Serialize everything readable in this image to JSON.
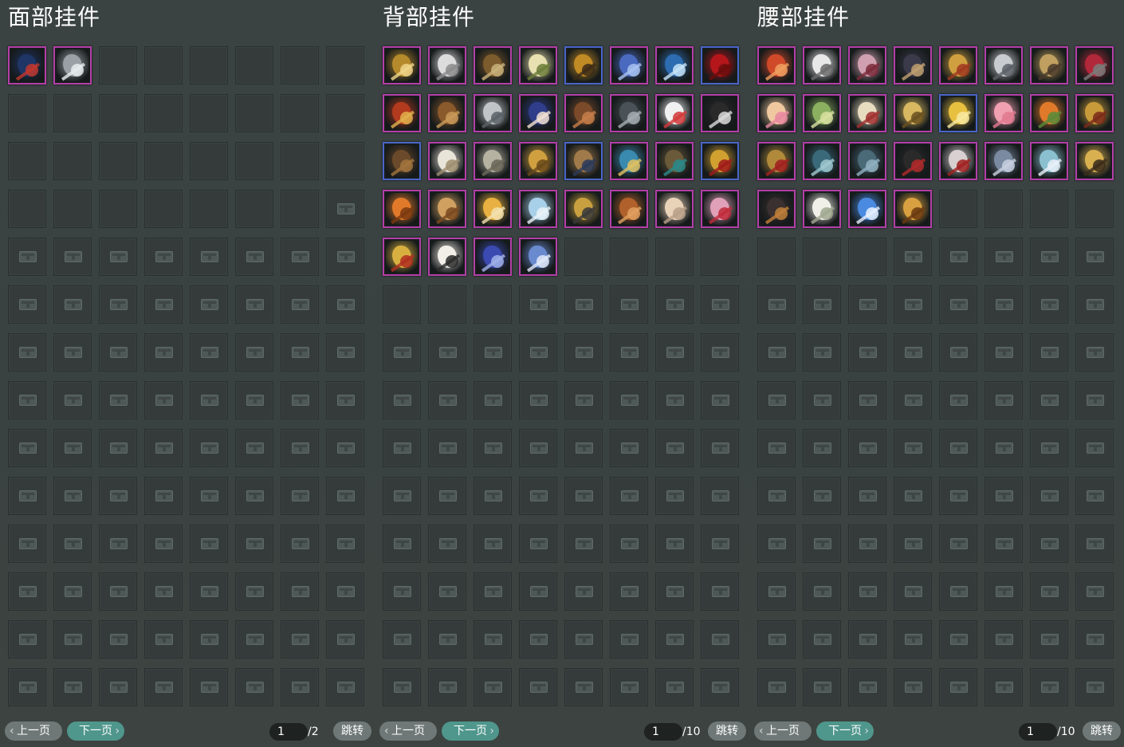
{
  "panels": [
    {
      "id": "face",
      "title": "面部挂件",
      "unlocked_slots": 31,
      "items": [
        {
          "icon": "blue-flower-hairpin-icon",
          "frame": "purple",
          "c1": "#1f3566",
          "c2": "#c2372d"
        },
        {
          "icon": "silver-mask-icon",
          "frame": "purple",
          "c1": "#9aa0a6",
          "c2": "#e7ecef"
        }
      ],
      "pager": {
        "prev_label": "上一页",
        "next_label": "下一页",
        "current_page": "1",
        "total_label": "/2",
        "jump_label": "跳转"
      }
    },
    {
      "id": "back",
      "title": "背部挂件",
      "unlocked_slots": 43,
      "items": [
        {
          "icon": "golden-wings-icon",
          "frame": "purple",
          "c1": "#b58a2c",
          "c2": "#f0d58a"
        },
        {
          "icon": "white-wings-icon",
          "frame": "purple",
          "c1": "#dcdcdc",
          "c2": "#8c8c8c"
        },
        {
          "icon": "ornate-fan-icon",
          "frame": "purple",
          "c1": "#7c5b2c",
          "c2": "#c9b27a"
        },
        {
          "icon": "lotus-flower-icon",
          "frame": "purple",
          "c1": "#e8e0b0",
          "c2": "#6c7d3a"
        },
        {
          "icon": "golden-guqin-icon",
          "frame": "blue",
          "c1": "#c08a24",
          "c2": "#3b2a18"
        },
        {
          "icon": "blue-rune-orb-icon",
          "frame": "purple",
          "c1": "#4a6ac0",
          "c2": "#a7c2f0"
        },
        {
          "icon": "blue-crystal-blade-icon",
          "frame": "purple",
          "c1": "#2d6cb0",
          "c2": "#c7e3f7"
        },
        {
          "icon": "red-phoenix-icon",
          "frame": "blue",
          "c1": "#b5161b",
          "c2": "#6a0d0d"
        },
        {
          "icon": "red-gold-fan-icon",
          "frame": "purple",
          "c1": "#b23a1e",
          "c2": "#e0b04c"
        },
        {
          "icon": "bird-cage-icon",
          "frame": "purple",
          "c1": "#8a5a2c",
          "c2": "#c89a5a"
        },
        {
          "icon": "silver-hammer-icon",
          "frame": "purple",
          "c1": "#c0c4c6",
          "c2": "#5a6266"
        },
        {
          "icon": "blue-penguin-icon",
          "frame": "purple",
          "c1": "#2f3d8a",
          "c2": "#f2e2d2"
        },
        {
          "icon": "wooden-kite-icon",
          "frame": "purple",
          "c1": "#7a4a2a",
          "c2": "#c67e4a"
        },
        {
          "icon": "dark-sword-bundle-icon",
          "frame": "purple",
          "c1": "#4a5258",
          "c2": "#a4adb2"
        },
        {
          "icon": "snowman-doll-icon",
          "frame": "purple",
          "c1": "#f1f1f1",
          "c2": "#d23a3a"
        },
        {
          "icon": "dark-thorn-ring-icon",
          "frame": "purple",
          "c1": "#2a2a2a",
          "c2": "#dadada"
        },
        {
          "icon": "wooden-barrel-icon",
          "frame": "blue",
          "c1": "#6a4a2a",
          "c2": "#a2743e"
        },
        {
          "icon": "white-vase-icon",
          "frame": "purple",
          "c1": "#e9e4d8",
          "c2": "#9f8f70"
        },
        {
          "icon": "silver-feather-disc-icon",
          "frame": "purple",
          "c1": "#b6b2a2",
          "c2": "#6b6658"
        },
        {
          "icon": "golden-scroll-sword-icon",
          "frame": "purple",
          "c1": "#d0a040",
          "c2": "#6a4a1a"
        },
        {
          "icon": "wooden-xylophone-icon",
          "frame": "blue",
          "c1": "#a07a4a",
          "c2": "#2a3a5a"
        },
        {
          "icon": "kingfisher-bird-icon",
          "frame": "purple",
          "c1": "#3a8ab0",
          "c2": "#e0c060"
        },
        {
          "icon": "wooden-cabinet-icon",
          "frame": "purple",
          "c1": "#6a5a3a",
          "c2": "#2a8a8a"
        },
        {
          "icon": "golden-red-chain-icon",
          "frame": "blue",
          "c1": "#d0a030",
          "c2": "#a01a1a"
        },
        {
          "icon": "orange-sun-orb-icon",
          "frame": "purple",
          "c1": "#e07a2a",
          "c2": "#7a3a10"
        },
        {
          "icon": "lantern-shrine-icon",
          "frame": "purple",
          "c1": "#d0a060",
          "c2": "#7a4a20"
        },
        {
          "icon": "golden-rabbit-icon",
          "frame": "purple",
          "c1": "#e8b040",
          "c2": "#f2e2b0"
        },
        {
          "icon": "snow-globe-icon",
          "frame": "purple",
          "c1": "#a8d0e8",
          "c2": "#e8f2f8"
        },
        {
          "icon": "golden-crossed-swords-icon",
          "frame": "purple",
          "c1": "#c8a040",
          "c2": "#3a3a3a"
        },
        {
          "icon": "bronze-shield-icon",
          "frame": "purple",
          "c1": "#b0602a",
          "c2": "#e0a060"
        },
        {
          "icon": "seashell-icon",
          "frame": "purple",
          "c1": "#e8d2b8",
          "c2": "#b8a088"
        },
        {
          "icon": "pink-plush-doll-icon",
          "frame": "purple",
          "c1": "#e0a0b8",
          "c2": "#c02a3a"
        },
        {
          "icon": "golden-fortune-doll-icon",
          "frame": "purple",
          "c1": "#d8b040",
          "c2": "#b03020"
        },
        {
          "icon": "white-dress-figure-icon",
          "frame": "purple",
          "c1": "#f2eee8",
          "c2": "#2a2a2a"
        },
        {
          "icon": "blue-crest-medallion-icon",
          "frame": "purple",
          "c1": "#3a4ab0",
          "c2": "#a0b0e8"
        },
        {
          "icon": "blue-spirit-jewel-icon",
          "frame": "purple",
          "c1": "#6a8ad0",
          "c2": "#e0e8f8"
        }
      ],
      "pager": {
        "prev_label": "上一页",
        "next_label": "下一页",
        "current_page": "1",
        "total_label": "/10",
        "jump_label": "跳转"
      }
    },
    {
      "id": "waist",
      "title": "腰部挂件",
      "unlocked_slots": 35,
      "items": [
        {
          "icon": "red-koi-fish-icon",
          "frame": "purple",
          "c1": "#d04a2a",
          "c2": "#f0a060"
        },
        {
          "icon": "white-tassel-sword-icon",
          "frame": "purple",
          "c1": "#e8e8e8",
          "c2": "#6a6a6a"
        },
        {
          "icon": "pink-mechanism-icon",
          "frame": "purple",
          "c1": "#d0a0b0",
          "c2": "#7a2a3a"
        },
        {
          "icon": "dark-pen-brush-icon",
          "frame": "purple",
          "c1": "#3a3a4a",
          "c2": "#c0a070"
        },
        {
          "icon": "golden-hanging-ornament-icon",
          "frame": "purple",
          "c1": "#d0a040",
          "c2": "#a03a20"
        },
        {
          "icon": "silver-ornament-icon",
          "frame": "purple",
          "c1": "#c8ccd0",
          "c2": "#5a6066"
        },
        {
          "icon": "golden-pendant-chain-icon",
          "frame": "purple",
          "c1": "#c0a060",
          "c2": "#4a3a2a"
        },
        {
          "icon": "red-rope-canteen-icon",
          "frame": "purple",
          "c1": "#b0283a",
          "c2": "#7a7a7a"
        },
        {
          "icon": "pink-bunny-plush-icon",
          "frame": "purple",
          "c1": "#f0c8a0",
          "c2": "#e88aa0"
        },
        {
          "icon": "green-gourd-ladle-icon",
          "frame": "purple",
          "c1": "#8ab060",
          "c2": "#d8e0a0"
        },
        {
          "icon": "paper-scroll-icon",
          "frame": "purple",
          "c1": "#e8dcc0",
          "c2": "#a03030"
        },
        {
          "icon": "golden-pipe-icon",
          "frame": "purple",
          "c1": "#d8b860",
          "c2": "#6a5020"
        },
        {
          "icon": "gold-ingot-icon",
          "frame": "blue",
          "c1": "#e8c040",
          "c2": "#f8e8a0"
        },
        {
          "icon": "pink-piggy-icon",
          "frame": "purple",
          "c1": "#f0a0b0",
          "c2": "#e07a90"
        },
        {
          "icon": "orange-fox-icon",
          "frame": "purple",
          "c1": "#e07a2a",
          "c2": "#5a8a3a"
        },
        {
          "icon": "golden-token-icon",
          "frame": "purple",
          "c1": "#c89a3a",
          "c2": "#7a2a1a"
        },
        {
          "icon": "golden-red-token-icon",
          "frame": "purple",
          "c1": "#b08a3a",
          "c2": "#a02020"
        },
        {
          "icon": "teal-scale-pouch-icon",
          "frame": "purple",
          "c1": "#3a6a7a",
          "c2": "#a0c8d0"
        },
        {
          "icon": "teal-stone-pouch-icon",
          "frame": "purple",
          "c1": "#4a6a78",
          "c2": "#90b0c0"
        },
        {
          "icon": "dark-katana-icon",
          "frame": "purple",
          "c1": "#2a2a2a",
          "c2": "#b02a2a"
        },
        {
          "icon": "red-skull-beads-icon",
          "frame": "purple",
          "c1": "#d8d0d0",
          "c2": "#a02020"
        },
        {
          "icon": "steel-armor-knot-icon",
          "frame": "purple",
          "c1": "#7a8aa0",
          "c2": "#c8d0e0"
        },
        {
          "icon": "crystal-chandelier-icon",
          "frame": "purple",
          "c1": "#8ac0d0",
          "c2": "#e8f0f8"
        },
        {
          "icon": "golden-incense-burner-icon",
          "frame": "purple",
          "c1": "#d8b050",
          "c2": "#3a2a1a"
        },
        {
          "icon": "dark-tassel-blade-icon",
          "frame": "purple",
          "c1": "#3a3030",
          "c2": "#c0803a"
        },
        {
          "icon": "white-dandelion-icon",
          "frame": "purple",
          "c1": "#f0f0e8",
          "c2": "#a0a890"
        },
        {
          "icon": "blue-cloud-orb-icon",
          "frame": "purple",
          "c1": "#4a8ae0",
          "c2": "#e8f0ff"
        },
        {
          "icon": "golden-dragon-icon",
          "frame": "purple",
          "c1": "#d8a040",
          "c2": "#6a3a10"
        }
      ],
      "pager": {
        "prev_label": "上一页",
        "next_label": "下一页",
        "current_page": "1",
        "total_label": "/10",
        "jump_label": "跳转"
      }
    }
  ]
}
